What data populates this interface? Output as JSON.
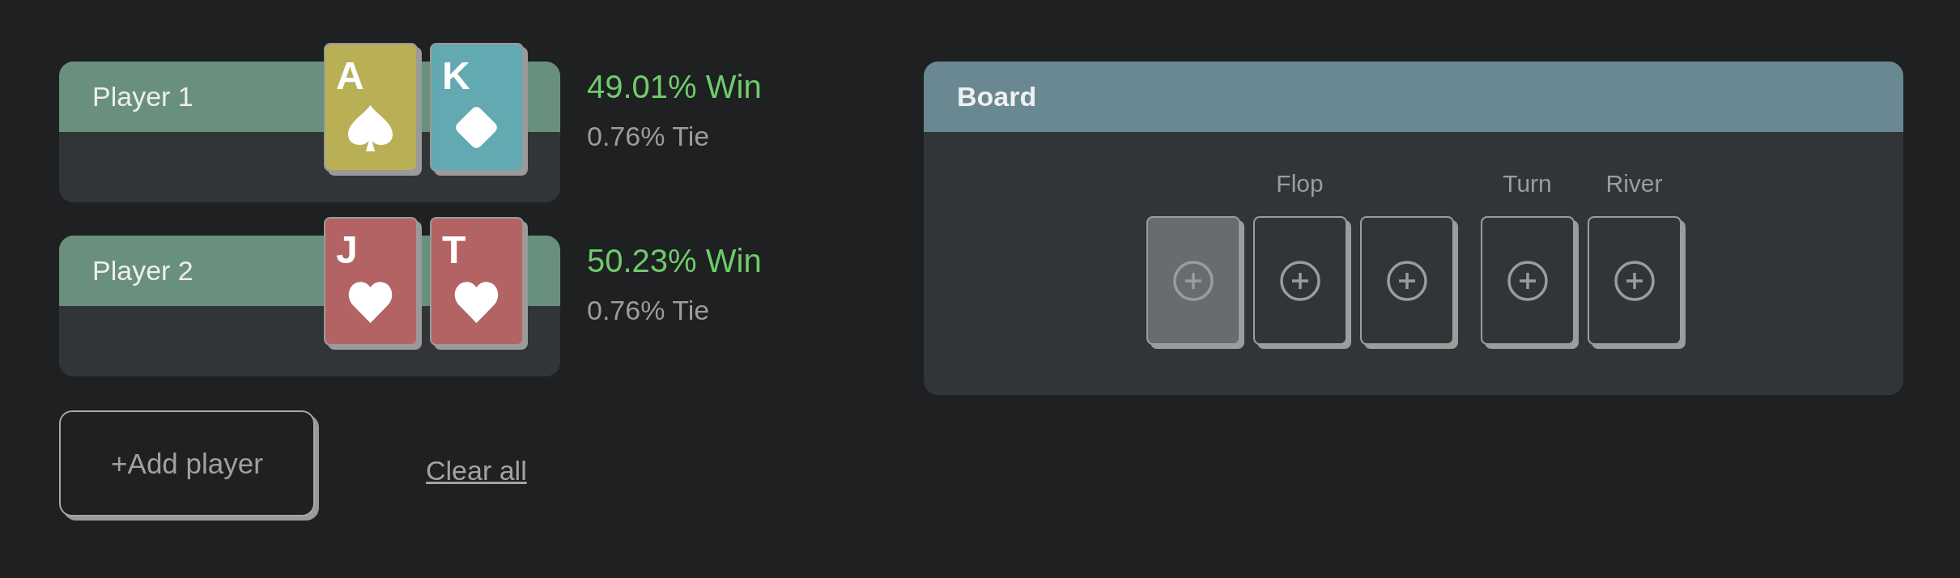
{
  "players": [
    {
      "name": "Player 1",
      "cards": [
        {
          "rank": "A",
          "kind": "spade",
          "color": "#b9b056"
        },
        {
          "rank": "K",
          "kind": "diamond",
          "color": "#62a9b2"
        }
      ],
      "win": "49.01% Win",
      "tie": "0.76% Tie"
    },
    {
      "name": "Player 2",
      "cards": [
        {
          "rank": "J",
          "kind": "heart",
          "color": "#b36363"
        },
        {
          "rank": "T",
          "kind": "heart",
          "color": "#b36363"
        }
      ],
      "win": "50.23% Win",
      "tie": "0.76% Tie"
    }
  ],
  "actions": {
    "add_button": "+Add player",
    "clear_link": "Clear all"
  },
  "board": {
    "title": "Board",
    "streets": [
      {
        "label": "Flop",
        "slots": [
          {
            "selected": true
          },
          {
            "selected": false
          },
          {
            "selected": false
          }
        ]
      },
      {
        "label": "Turn",
        "slots": [
          {
            "selected": false
          }
        ]
      },
      {
        "label": "River",
        "slots": [
          {
            "selected": false
          }
        ]
      }
    ]
  }
}
